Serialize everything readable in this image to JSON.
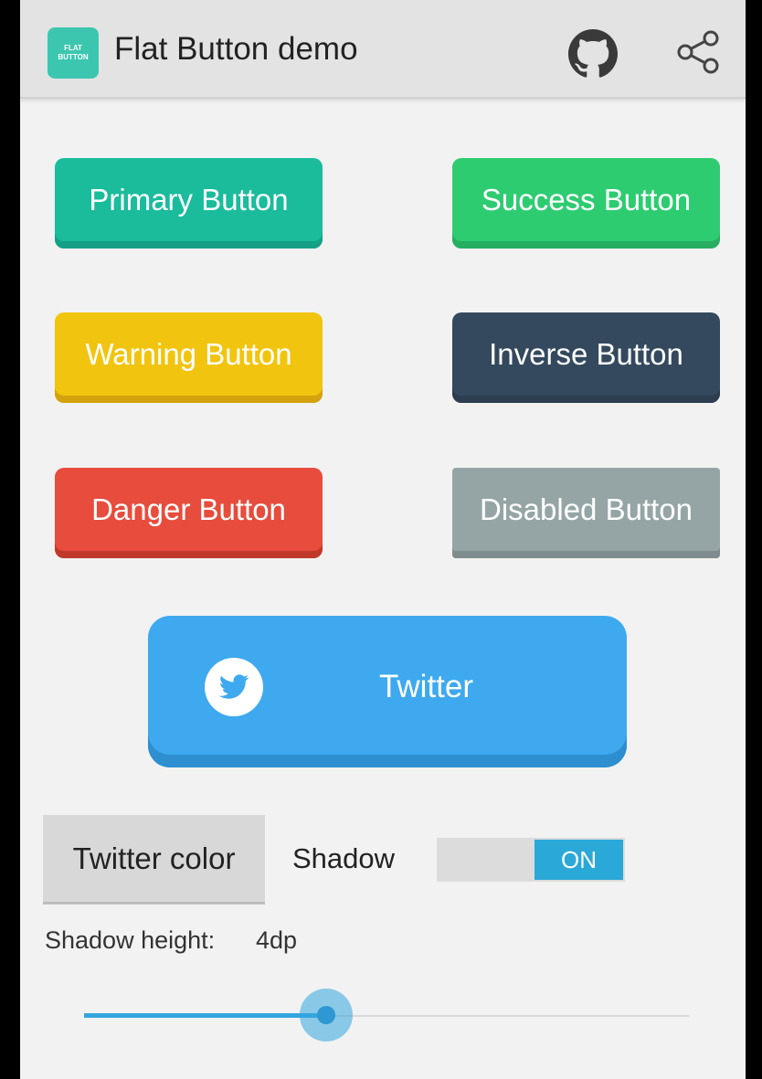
{
  "app": {
    "logo_line1": "FLAT",
    "logo_line2": "BUTTON",
    "title": "Flat Button demo"
  },
  "buttons": {
    "primary": "Primary Button",
    "success": "Success Button",
    "warning": "Warning Button",
    "inverse": "Inverse Button",
    "danger": "Danger Button",
    "disabled": "Disabled Button",
    "twitter": "Twitter"
  },
  "controls": {
    "color_button": "Twitter color",
    "shadow_label": "Shadow",
    "shadow_toggle": "ON",
    "shadow_height_label": "Shadow height:",
    "shadow_height_value": "4dp",
    "slider_fraction": 0.4
  },
  "colors": {
    "primary": "#1abc9c",
    "success": "#2ecc71",
    "warning": "#f1c40f",
    "inverse": "#34495e",
    "danger": "#e74c3c",
    "disabled": "#95a5a6",
    "twitter": "#3ea9ee",
    "accent": "#33a6df"
  },
  "icons": [
    "github-icon",
    "share-icon",
    "twitter-bird-icon"
  ]
}
